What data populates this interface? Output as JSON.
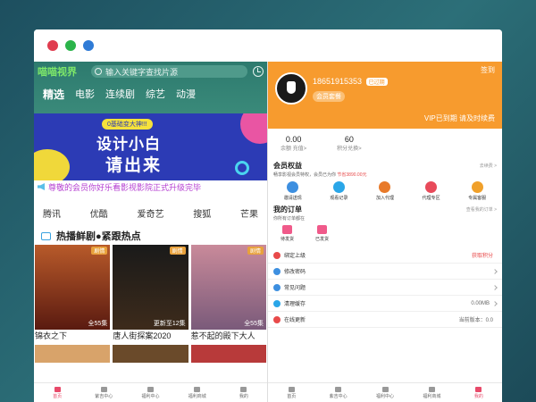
{
  "left": {
    "brand": "喵喵视界",
    "search_placeholder": "输入关键字查找片源",
    "categories": [
      "精选",
      "电影",
      "连续剧",
      "综艺",
      "动漫"
    ],
    "banner": {
      "small": "0基础变大神!!!",
      "line1": "设计小白",
      "line2": "请出来"
    },
    "notice": "尊敬的会员你好乐看影视影院正式升级完毕",
    "sources": [
      "腾讯",
      "优酷",
      "爱奇艺",
      "搜狐",
      "芒果"
    ],
    "section_title": "热播鲜剧●紧跟热点",
    "movies": [
      {
        "title": "锦衣之下",
        "tag": "剧情",
        "ep": "全55集"
      },
      {
        "title": "唐人街探案2020",
        "tag": "剧情",
        "ep": "更新至12集"
      },
      {
        "title": "惹不起的殿下大人",
        "tag": "剧情",
        "ep": "全55集"
      }
    ],
    "tabs": [
      "首页",
      "紫吉中心",
      "福利中心",
      "福利商城",
      "我的"
    ]
  },
  "right": {
    "logout": "签到",
    "phone": "18651915353",
    "badge": "已过期",
    "plan": "会员套餐",
    "vip": "VIP已到期 请及时续费",
    "stats": [
      {
        "n": "0.00",
        "l": "余额 充值>"
      },
      {
        "n": "60",
        "l": "积分兑换>"
      }
    ],
    "member": {
      "title": "会员权益",
      "more": "去续费 >",
      "sub": "畅享影视会员特权，会员已为你",
      "saving": "节省3890.00元"
    },
    "member_icons": [
      "邀请送现",
      "观看记录",
      "加入代理",
      "代理专区",
      "专属客服"
    ],
    "orders": {
      "title": "我的订单",
      "more": "查看我的订单 >",
      "sub": "你所有订单都在",
      "items": [
        "待发货",
        "已发货"
      ]
    },
    "menu": [
      {
        "label": "绑定上级",
        "value": "获取积分",
        "red": true
      },
      {
        "label": "修改密码",
        "value": ""
      },
      {
        "label": "常见问题",
        "value": ""
      },
      {
        "label": "清理缓存",
        "value": "0.00MB"
      },
      {
        "label": "在线更新",
        "value": "当前版本：0.0"
      }
    ],
    "tabs": [
      "首页",
      "紫吉中心",
      "福利中心",
      "福利商城",
      "我的"
    ]
  }
}
